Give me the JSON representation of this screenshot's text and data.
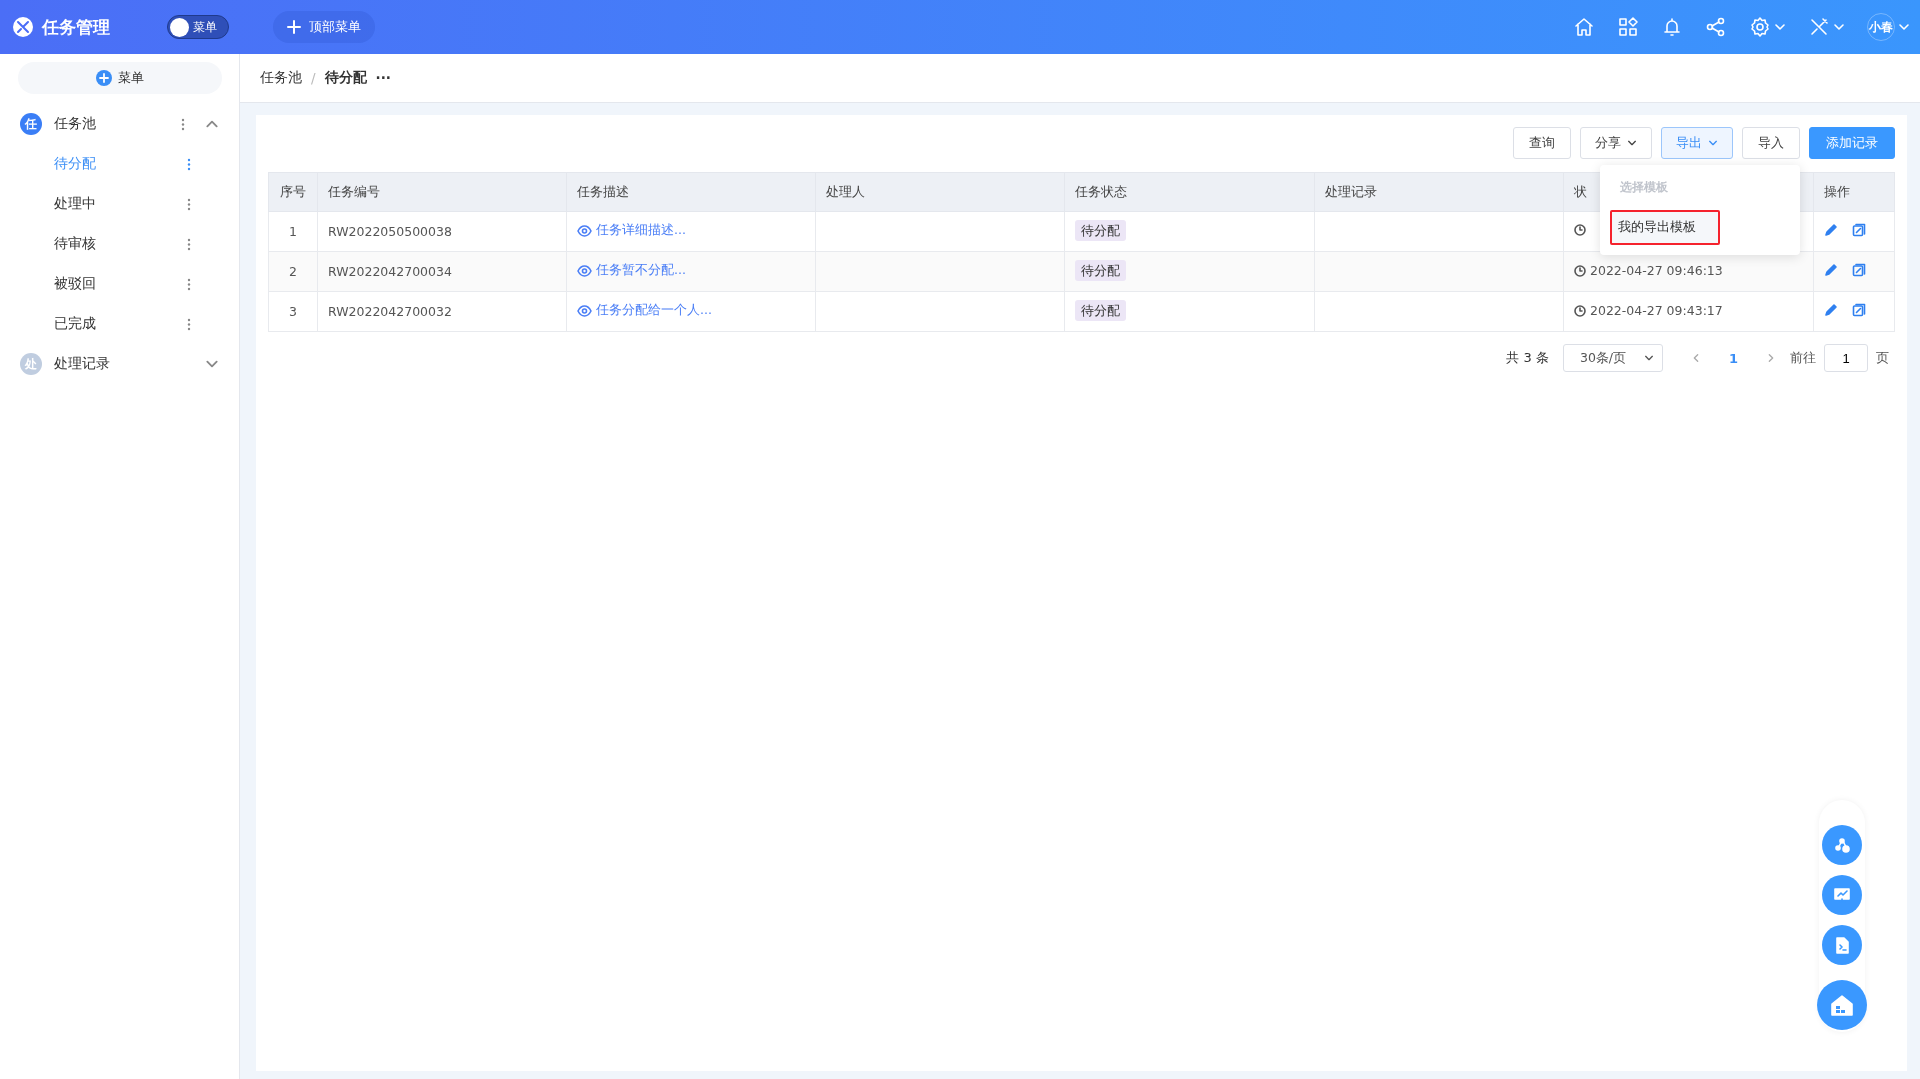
{
  "app": {
    "title": "任务管理",
    "toggle": {
      "label": "菜单",
      "on": false
    },
    "top_menu_button": "顶部菜单",
    "user": "小春"
  },
  "sidebar": {
    "add_button": "菜单",
    "items": [
      {
        "label": "任务池",
        "badge": "任",
        "expanded": true,
        "selected": false,
        "children": [
          {
            "label": "待分配",
            "selected": true
          },
          {
            "label": "处理中",
            "selected": false
          },
          {
            "label": "待审核",
            "selected": false
          },
          {
            "label": "被驳回",
            "selected": false
          },
          {
            "label": "已完成",
            "selected": false
          }
        ]
      },
      {
        "label": "处理记录",
        "badge": "处",
        "expanded": false,
        "selected": false
      }
    ]
  },
  "breadcrumb": {
    "items": [
      "任务池",
      "待分配"
    ],
    "separator": "/",
    "more": "···"
  },
  "toolbar": [
    {
      "label": "查询",
      "kind": "plain"
    },
    {
      "label": "分享",
      "kind": "dropdown",
      "open": false
    },
    {
      "label": "导出",
      "kind": "dropdown",
      "open": true
    },
    {
      "label": "导入",
      "kind": "plain"
    },
    {
      "label": "添加记录",
      "kind": "primary"
    }
  ],
  "export_menu": {
    "header": "选择模板",
    "items": [
      {
        "label": "我的导出模板",
        "highlighted": true
      }
    ]
  },
  "table": {
    "columns": [
      "序号",
      "任务编号",
      "任务描述",
      "处理人",
      "任务状态",
      "处理记录",
      "状",
      "操作"
    ],
    "rows": [
      {
        "index": "1",
        "code": "RW2022050500038",
        "description": "任务详细描述...",
        "status": "待分配"
      },
      {
        "index": "2",
        "code": "RW2022042700034",
        "description": "任务暂不分配...",
        "status": "待分配",
        "time": "2022-04-27 09:46:13"
      },
      {
        "index": "3",
        "code": "RW2022042700032",
        "description": "任务分配给一个人...",
        "status": "待分配",
        "time": "2022-04-27 09:43:17"
      }
    ]
  },
  "pagination": {
    "total": "共 3 条",
    "page_size": "30条/页",
    "pages": [
      {
        "label": "1",
        "selected": true
      }
    ],
    "goto_label": "前往",
    "goto_value": "1",
    "page_suffix": "页"
  }
}
